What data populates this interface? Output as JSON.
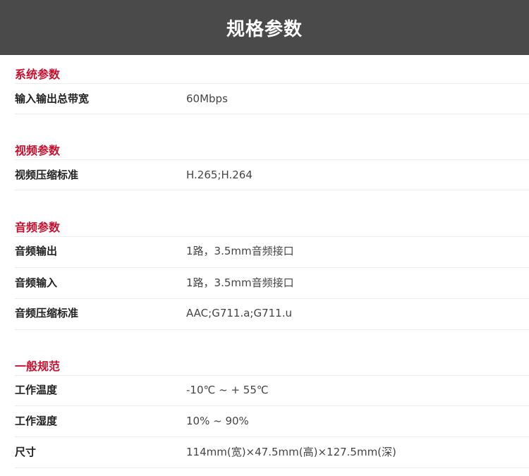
{
  "header": {
    "title": "规格参数"
  },
  "sections": [
    {
      "title": "系统参数",
      "rows": [
        {
          "label": "输入输出总带宽",
          "value": "60Mbps"
        }
      ]
    },
    {
      "title": "视频参数",
      "rows": [
        {
          "label": "视频压缩标准",
          "value": "H.265;H.264"
        }
      ]
    },
    {
      "title": "音频参数",
      "rows": [
        {
          "label": "音频输出",
          "value": "1路，3.5mm音频接口"
        },
        {
          "label": "音频输入",
          "value": "1路，3.5mm音频接口"
        },
        {
          "label": "音频压缩标准",
          "value": "AAC;G711.a;G711.u"
        }
      ]
    },
    {
      "title": "一般规范",
      "rows": [
        {
          "label": "工作温度",
          "value": "-10℃ ~ + 55℃"
        },
        {
          "label": "工作湿度",
          "value": "10% ~ 90%"
        },
        {
          "label": "尺寸",
          "value": "114mm(宽)×47.5mm(高)×127.5mm(深)"
        }
      ]
    }
  ],
  "colors": {
    "header_bg": "#4a4a4a",
    "section_title": "#c8102e",
    "divider": "#ececec"
  }
}
